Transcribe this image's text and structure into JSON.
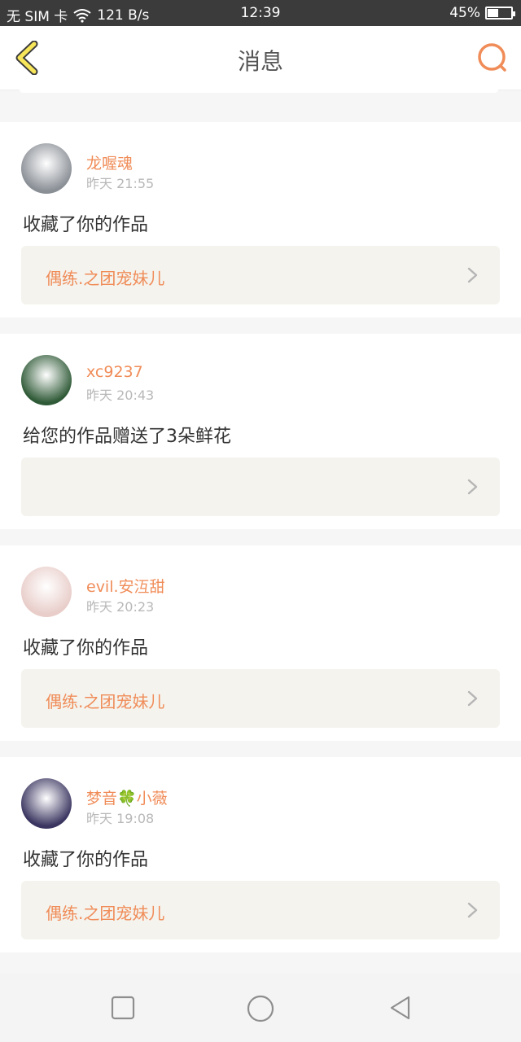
{
  "status": {
    "carrier": "无 SIM 卡",
    "speed": "121 B/s",
    "time": "12:39",
    "battery": "45%",
    "battery_level": 0.45
  },
  "header": {
    "title": "消息",
    "accent": "#f08c58"
  },
  "messages": [
    {
      "user": "龙喔魂",
      "time": "昨天 21:55",
      "action": "收藏了你的作品",
      "work": "偶练.之团宠妹儿",
      "avatar_color": "#8a8f96"
    },
    {
      "user": "xc9237",
      "time": "昨天 20:43",
      "action": "给您的作品赠送了3朵鲜花",
      "work": "",
      "avatar_color": "#2f5a37"
    },
    {
      "user": "evil.安沍甜",
      "time": "昨天 20:23",
      "action": "收藏了你的作品",
      "work": "偶练.之团宠妹儿",
      "avatar_color": "#e8cdc9"
    },
    {
      "user": "梦音🍀小薇",
      "time": "昨天 19:08",
      "action": "收藏了你的作品",
      "work": "偶练.之团宠妹儿",
      "avatar_color": "#3a3560"
    }
  ],
  "navbar": {
    "recents": "square-icon",
    "home": "circle-icon",
    "back": "triangle-back-icon"
  }
}
